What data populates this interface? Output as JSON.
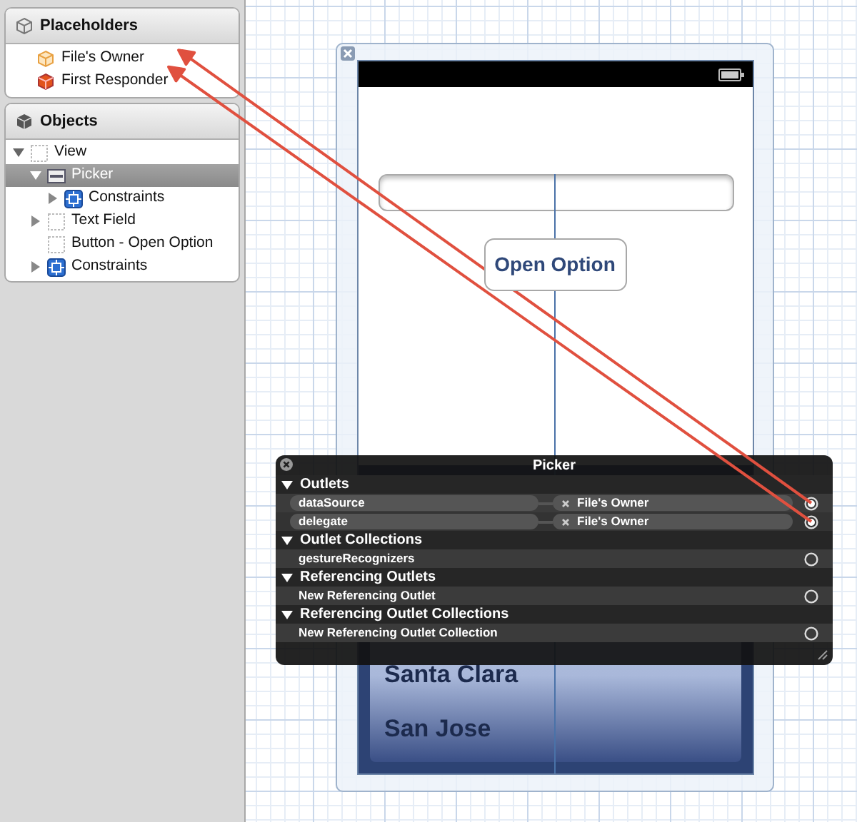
{
  "placeholders": {
    "title": "Placeholders",
    "items": [
      {
        "label": "File's Owner",
        "kind": "owner"
      },
      {
        "label": "First Responder",
        "kind": "responder"
      }
    ]
  },
  "objects": {
    "title": "Objects",
    "items": [
      {
        "label": "View",
        "kind": "view",
        "expanded": true,
        "selected": false,
        "children": [
          {
            "label": "Picker",
            "kind": "picker",
            "expanded": true,
            "selected": true,
            "children": [
              {
                "label": "Constraints",
                "kind": "constraints",
                "expanded": false,
                "selected": false
              }
            ]
          },
          {
            "label": "Text Field",
            "kind": "view",
            "expanded": false,
            "selected": false
          },
          {
            "label": "Button - Open Option",
            "kind": "view",
            "selected": false
          },
          {
            "label": "Constraints",
            "kind": "constraints",
            "expanded": false,
            "selected": false
          }
        ]
      }
    ]
  },
  "phone": {
    "button": "Open Option",
    "picker_rows": [
      "Santa Clara",
      "San Jose"
    ]
  },
  "inspector": {
    "title": "Picker",
    "sections": [
      {
        "title": "Outlets",
        "expanded": true,
        "rows": [
          {
            "name": "dataSource",
            "target": "File's Owner",
            "connected": true
          },
          {
            "name": "delegate",
            "target": "File's Owner",
            "connected": true
          }
        ]
      },
      {
        "title": "Outlet Collections",
        "expanded": true,
        "rows": [
          {
            "name": "gestureRecognizers",
            "connected": false
          }
        ]
      },
      {
        "title": "Referencing Outlets",
        "expanded": true,
        "rows": [
          {
            "name": "New Referencing Outlet",
            "connected": false
          }
        ]
      },
      {
        "title": "Referencing Outlet Collections",
        "expanded": true,
        "rows": [
          {
            "name": "New Referencing Outlet Collection",
            "connected": false
          }
        ]
      }
    ]
  }
}
